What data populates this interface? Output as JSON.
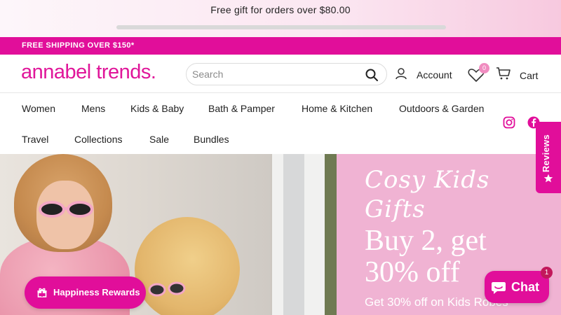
{
  "announcement": {
    "text": "Free gift for orders over $80.00",
    "progress": 0
  },
  "shipping_bar": {
    "text": "FREE SHIPPING OVER $150*"
  },
  "header": {
    "logo": "annabel trends.",
    "search_placeholder": "Search",
    "account_label": "Account",
    "wishlist_count": "0",
    "cart_label": "Cart"
  },
  "nav": {
    "items": [
      "Women",
      "Mens",
      "Kids & Baby",
      "Bath & Pamper",
      "Home & Kitchen",
      "Outdoors & Garden",
      "Travel",
      "Collections",
      "Sale",
      "Bundles"
    ]
  },
  "hero": {
    "script_title": "Cosy Kids Gifts",
    "headline": "Buy 2, get 30% off",
    "subtext": "Get 30% off on Kids Robes"
  },
  "reviews_tab": {
    "label": "Reviews"
  },
  "rewards": {
    "label": "Happiness Rewards"
  },
  "chat": {
    "label": "Chat",
    "badge": "1"
  },
  "colors": {
    "brand_pink": "#e10e9a",
    "promo_bg": "#f0b3d3",
    "wish_badge": "#f08cc0"
  },
  "icons": {
    "search": "search-icon",
    "account": "user-icon",
    "wishlist": "heart-icon",
    "cart": "cart-icon",
    "instagram": "instagram-icon",
    "facebook": "facebook-icon",
    "reviews": "star-icon",
    "rewards": "gift-icon",
    "chat": "chat-bubble-icon"
  }
}
